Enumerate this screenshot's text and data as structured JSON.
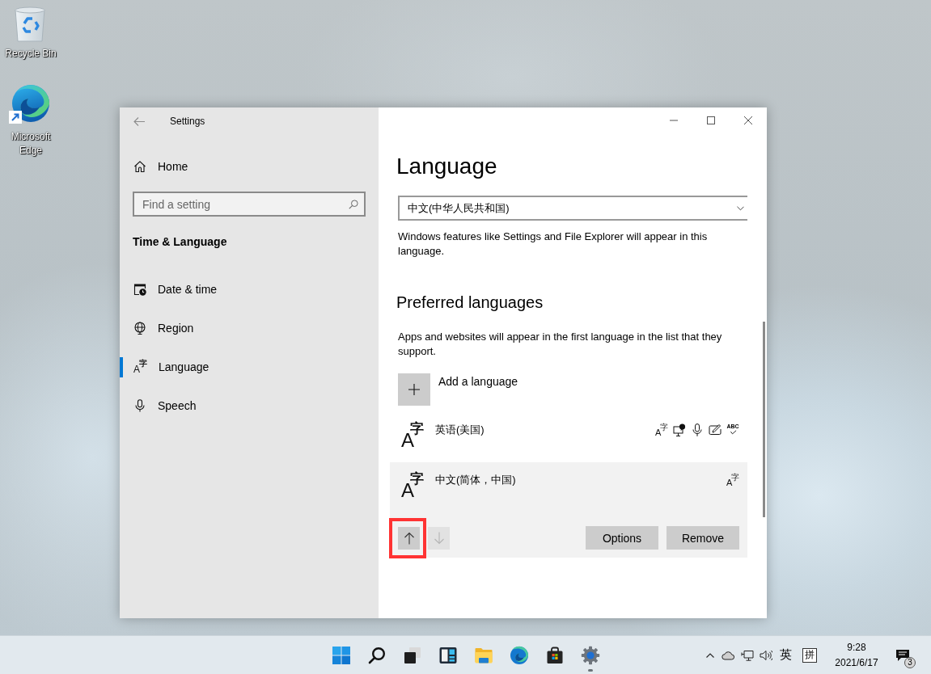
{
  "desktop": {
    "icons": [
      {
        "kind": "recycle-bin",
        "label": "Recycle Bin"
      },
      {
        "kind": "edge",
        "label": "Microsoft Edge"
      }
    ]
  },
  "window": {
    "title": "Settings"
  },
  "sidebar": {
    "home": "Home",
    "search": {
      "placeholder": "Find a setting"
    },
    "section": "Time & Language",
    "items": [
      {
        "kind": "date-time",
        "label": "Date & time",
        "selected": false
      },
      {
        "kind": "region",
        "label": "Region",
        "selected": false
      },
      {
        "kind": "language",
        "label": "Language",
        "selected": true,
        "icon": [
          "A",
          "字"
        ]
      },
      {
        "kind": "speech",
        "label": "Speech",
        "selected": false
      }
    ]
  },
  "page": {
    "title": "Language",
    "display_language": {
      "value": "中文(中华人民共和国)"
    },
    "display_note": "Windows features like Settings and File Explorer will appear in this language.",
    "preferred_title": "Preferred languages",
    "preferred_note": "Apps and websites will appear in the first language in the list that they support.",
    "add_label": "Add a language",
    "languages": [
      {
        "icon": [
          "A",
          "字"
        ],
        "name": "英语(美国)",
        "selected": false,
        "features": [
          {
            "kind": "language-pack",
            "glyphs": [
              "A",
              "字"
            ]
          },
          {
            "kind": "display"
          },
          {
            "kind": "speech"
          },
          {
            "kind": "handwriting"
          },
          {
            "kind": "spelling",
            "glyphs": [
              "ABC"
            ]
          }
        ]
      },
      {
        "icon": [
          "A",
          "字"
        ],
        "name": "中文(简体，中国)",
        "selected": true,
        "features": [
          {
            "kind": "language-pack",
            "glyphs": [
              "A",
              "字"
            ]
          }
        ],
        "actions": {
          "move_up": {
            "disabled": false,
            "highlighted": true
          },
          "move_down": {
            "disabled": true,
            "highlighted": false
          },
          "buttons": [
            "Options",
            "Remove"
          ]
        }
      }
    ]
  },
  "taskbar": {
    "apps": [
      {
        "kind": "start",
        "running": false
      },
      {
        "kind": "search",
        "running": false
      },
      {
        "kind": "task-view",
        "running": false
      },
      {
        "kind": "widgets",
        "running": false
      },
      {
        "kind": "file-explorer",
        "running": false
      },
      {
        "kind": "edge",
        "running": false
      },
      {
        "kind": "store",
        "running": false
      },
      {
        "kind": "settings",
        "running": true
      }
    ],
    "tray": {
      "input_mode": "英",
      "ime": "拼",
      "time": "9:28",
      "date": "2021/6/17",
      "notifications": "3"
    }
  }
}
